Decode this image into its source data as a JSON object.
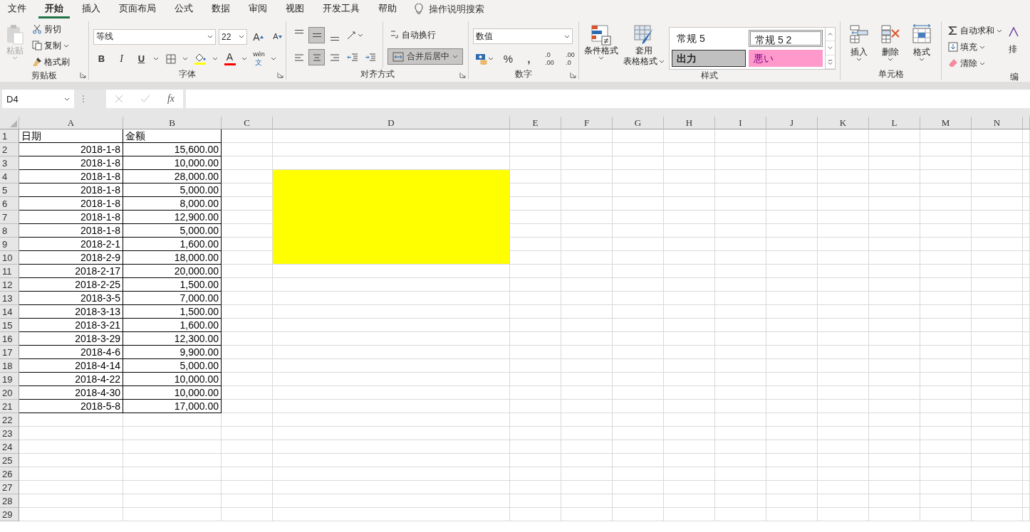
{
  "menu_tabs": [
    {
      "label": "文件",
      "selected": false
    },
    {
      "label": "开始",
      "selected": true
    },
    {
      "label": "插入",
      "selected": false
    },
    {
      "label": "页面布局",
      "selected": false
    },
    {
      "label": "公式",
      "selected": false
    },
    {
      "label": "数据",
      "selected": false
    },
    {
      "label": "审阅",
      "selected": false
    },
    {
      "label": "视图",
      "selected": false
    },
    {
      "label": "开发工具",
      "selected": false
    },
    {
      "label": "帮助",
      "selected": false
    }
  ],
  "search_hint": "操作说明搜索",
  "ribbon": {
    "clipboard": {
      "label": "剪贴板",
      "paste": {
        "label": "粘贴",
        "disabled": true
      },
      "cut": "剪切",
      "copy": "复制",
      "painter": "格式刷"
    },
    "font": {
      "label": "字体",
      "name": "等线",
      "size": "22",
      "grow": "A",
      "shrink": "A",
      "bold": "B",
      "italic": "I",
      "underline": "U",
      "color_letter": "A",
      "phonetic_top": "wén",
      "phonetic_bottom": "文"
    },
    "alignment": {
      "label": "对齐方式",
      "vertical": [
        {
          "selected": false
        },
        {
          "selected": true
        },
        {
          "selected": false
        }
      ],
      "horizontal": [
        {
          "selected": false
        },
        {
          "selected": true
        },
        {
          "selected": false
        }
      ],
      "wrap": "自动换行",
      "merge": {
        "label": "合并后居中",
        "selected": true
      }
    },
    "number": {
      "label": "数字",
      "format": "数值",
      "percent": "%",
      "comma": ",",
      "inc_top": ".0",
      "inc_bottom": ".00",
      "dec_top": ".00",
      "dec_bottom": ".0"
    },
    "styles": {
      "label": "样式",
      "conditional": "条件格式",
      "table_top": "套用",
      "table_bottom": "表格格式",
      "gallery": [
        {
          "label": "常规 5",
          "kind": "normal",
          "selected": false
        },
        {
          "label": "常规 5 2",
          "kind": "normal",
          "selected": true
        },
        {
          "label": "出力",
          "kind": "output",
          "selected": false
        },
        {
          "label": "悪い",
          "kind": "bad",
          "selected": false
        }
      ]
    },
    "cells": {
      "label": "单元格",
      "buttons": [
        "插入",
        "删除",
        "格式"
      ]
    },
    "editing": {
      "label": "编",
      "autosum": "自动求和",
      "fill": "填充",
      "clear": "清除",
      "sort": "排"
    }
  },
  "formula_bar": {
    "name_box": "D4",
    "fx": "fx"
  },
  "sheet": {
    "columns": [
      "A",
      "B",
      "C",
      "D",
      "E",
      "F",
      "G",
      "H",
      "I",
      "J",
      "K",
      "L",
      "M",
      "N"
    ],
    "rows": [
      {
        "number": "1",
        "cells": [
          "日期",
          "金额"
        ]
      },
      {
        "number": "2",
        "cells": [
          "2018-1-8",
          "15,600.00"
        ]
      },
      {
        "number": "3",
        "cells": [
          "2018-1-8",
          "10,000.00"
        ]
      },
      {
        "number": "4",
        "cells": [
          "2018-1-8",
          "28,000.00"
        ]
      },
      {
        "number": "5",
        "cells": [
          "2018-1-8",
          "5,000.00"
        ]
      },
      {
        "number": "6",
        "cells": [
          "2018-1-8",
          "8,000.00"
        ]
      },
      {
        "number": "7",
        "cells": [
          "2018-1-8",
          "12,900.00"
        ]
      },
      {
        "number": "8",
        "cells": [
          "2018-1-8",
          "5,000.00"
        ]
      },
      {
        "number": "9",
        "cells": [
          "2018-2-1",
          "1,600.00"
        ]
      },
      {
        "number": "10",
        "cells": [
          "2018-2-9",
          "18,000.00"
        ]
      },
      {
        "number": "11",
        "cells": [
          "2018-2-17",
          "20,000.00"
        ]
      },
      {
        "number": "12",
        "cells": [
          "2018-2-25",
          "1,500.00"
        ]
      },
      {
        "number": "13",
        "cells": [
          "2018-3-5",
          "7,000.00"
        ]
      },
      {
        "number": "14",
        "cells": [
          "2018-3-13",
          "1,500.00"
        ]
      },
      {
        "number": "15",
        "cells": [
          "2018-3-21",
          "1,600.00"
        ]
      },
      {
        "number": "16",
        "cells": [
          "2018-3-29",
          "12,300.00"
        ]
      },
      {
        "number": "17",
        "cells": [
          "2018-4-6",
          "9,900.00"
        ]
      },
      {
        "number": "18",
        "cells": [
          "2018-4-14",
          "5,000.00"
        ]
      },
      {
        "number": "19",
        "cells": [
          "2018-4-22",
          "10,000.00"
        ]
      },
      {
        "number": "20",
        "cells": [
          "2018-4-30",
          "10,000.00"
        ]
      },
      {
        "number": "21",
        "cells": [
          "2018-5-8",
          "17,000.00"
        ]
      },
      {
        "number": "22",
        "cells": []
      },
      {
        "number": "23",
        "cells": []
      },
      {
        "number": "24",
        "cells": []
      },
      {
        "number": "25",
        "cells": []
      },
      {
        "number": "26",
        "cells": []
      },
      {
        "number": "27",
        "cells": []
      },
      {
        "number": "28",
        "cells": []
      },
      {
        "number": "29",
        "cells": []
      }
    ]
  }
}
